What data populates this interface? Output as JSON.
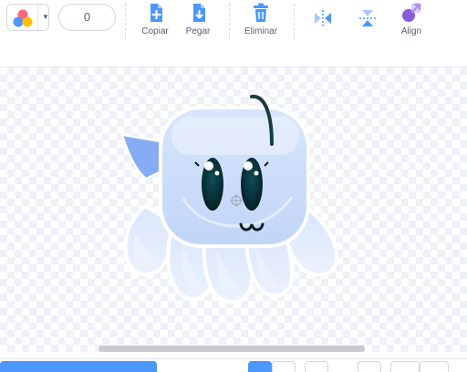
{
  "toolbar": {
    "fill_color_button": {
      "icon": "color-palette-icon"
    },
    "outline_width": "0",
    "copy_label": "Copiar",
    "paste_label": "Pegar",
    "delete_label": "Eliminar",
    "flip_horizontal": {
      "icon": "flip-horizontal-icon"
    },
    "flip_vertical": {
      "icon": "flip-vertical-icon"
    },
    "align_label": "Align"
  },
  "colors": {
    "accent": "#4c97ff",
    "text": "#575e75",
    "align_icon": "#855cd6",
    "delete_icon": "#4c97ff"
  },
  "canvas": {
    "sprite": "jellyfish-ghost-costume"
  }
}
